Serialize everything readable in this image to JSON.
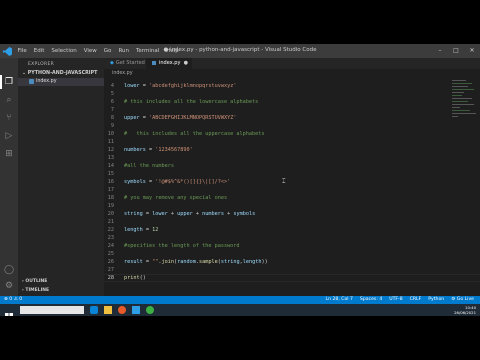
{
  "window": {
    "title": "● index.py - python-and-javascript - Visual Studio Code",
    "menu": [
      "File",
      "Edit",
      "Selection",
      "View",
      "Go",
      "Run",
      "Terminal",
      "Help"
    ]
  },
  "sidebar": {
    "title": "EXPLORER",
    "folder": "PYTHON-AND-JAVASCRIPT",
    "file": "index.py",
    "outline": "OUTLINE",
    "timeline": "TIMELINE"
  },
  "tabs": [
    {
      "label": "Get Started"
    },
    {
      "label": "index.py"
    }
  ],
  "breadcrumb": "index.py",
  "editor": {
    "lines": [
      {
        "n": "4",
        "tokens": [
          [
            "v",
            "lower"
          ],
          [
            "o",
            " = "
          ],
          [
            "s",
            "'abcdefghijklmnopqrstuvwxyz'"
          ]
        ]
      },
      {
        "n": "5",
        "tokens": []
      },
      {
        "n": "6",
        "tokens": [
          [
            "c",
            "# this includes all the lowercase alphabets"
          ]
        ]
      },
      {
        "n": "7",
        "tokens": []
      },
      {
        "n": "8",
        "tokens": [
          [
            "v",
            "upper"
          ],
          [
            "o",
            " = "
          ],
          [
            "s",
            "'ABCDEFGHIJKLMNOPQRSTUVWXYZ'"
          ]
        ]
      },
      {
        "n": "9",
        "tokens": []
      },
      {
        "n": "10",
        "tokens": [
          [
            "c",
            "#   this includes all the uppercase alphabets"
          ]
        ]
      },
      {
        "n": "11",
        "tokens": []
      },
      {
        "n": "12",
        "tokens": [
          [
            "v",
            "numbers"
          ],
          [
            "o",
            " = "
          ],
          [
            "s",
            "'1234567890'"
          ]
        ]
      },
      {
        "n": "13",
        "tokens": []
      },
      {
        "n": "14",
        "tokens": [
          [
            "c",
            "#all the numbers"
          ]
        ]
      },
      {
        "n": "15",
        "tokens": []
      },
      {
        "n": "16",
        "tokens": [
          [
            "v",
            "symbols"
          ],
          [
            "o",
            " = "
          ],
          [
            "s",
            "'!@#$%^&*()[]{}\\|[]/?<>'"
          ]
        ]
      },
      {
        "n": "17",
        "tokens": []
      },
      {
        "n": "18",
        "tokens": [
          [
            "c",
            "# you may remove any special ones"
          ]
        ]
      },
      {
        "n": "19",
        "tokens": []
      },
      {
        "n": "20",
        "tokens": [
          [
            "v",
            "string"
          ],
          [
            "o",
            " = "
          ],
          [
            "v",
            "lower"
          ],
          [
            "o",
            " + "
          ],
          [
            "v",
            "upper"
          ],
          [
            "o",
            " + "
          ],
          [
            "v",
            "numbers"
          ],
          [
            "o",
            " + "
          ],
          [
            "v",
            "symbols"
          ]
        ]
      },
      {
        "n": "21",
        "tokens": []
      },
      {
        "n": "22",
        "tokens": [
          [
            "v",
            "length"
          ],
          [
            "o",
            " = "
          ],
          [
            "n",
            "12"
          ]
        ]
      },
      {
        "n": "23",
        "tokens": []
      },
      {
        "n": "24",
        "tokens": [
          [
            "c",
            "#specifies the length of the password"
          ]
        ]
      },
      {
        "n": "25",
        "tokens": []
      },
      {
        "n": "26",
        "tokens": [
          [
            "v",
            "result"
          ],
          [
            "o",
            " = "
          ],
          [
            "s",
            "\"\""
          ],
          [
            "o",
            "."
          ],
          [
            "f",
            "join"
          ],
          [
            "o",
            "("
          ],
          [
            "v",
            "random"
          ],
          [
            "o",
            "."
          ],
          [
            "f",
            "sample"
          ],
          [
            "o",
            "("
          ],
          [
            "v",
            "string"
          ],
          [
            "o",
            ","
          ],
          [
            "v",
            "length"
          ],
          [
            "o",
            "))"
          ]
        ]
      },
      {
        "n": "27",
        "tokens": []
      },
      {
        "n": "28",
        "tokens": [
          [
            "f",
            "print"
          ],
          [
            "o",
            "()"
          ]
        ]
      }
    ]
  },
  "statusbar": {
    "left": "⊗ 0 ⚠ 0",
    "right": [
      "Ln 28, Col 7",
      "Spaces: 4",
      "UTF-8",
      "CRLF",
      "Python",
      "⚙ Go Live"
    ]
  },
  "taskbar": {
    "time": "10:40",
    "date": "26/06/2021"
  },
  "colors": {
    "editor_bg": "#1e1e1e",
    "statusbar": "#007acc",
    "sidebar": "#252526",
    "activitybar": "#333333"
  }
}
